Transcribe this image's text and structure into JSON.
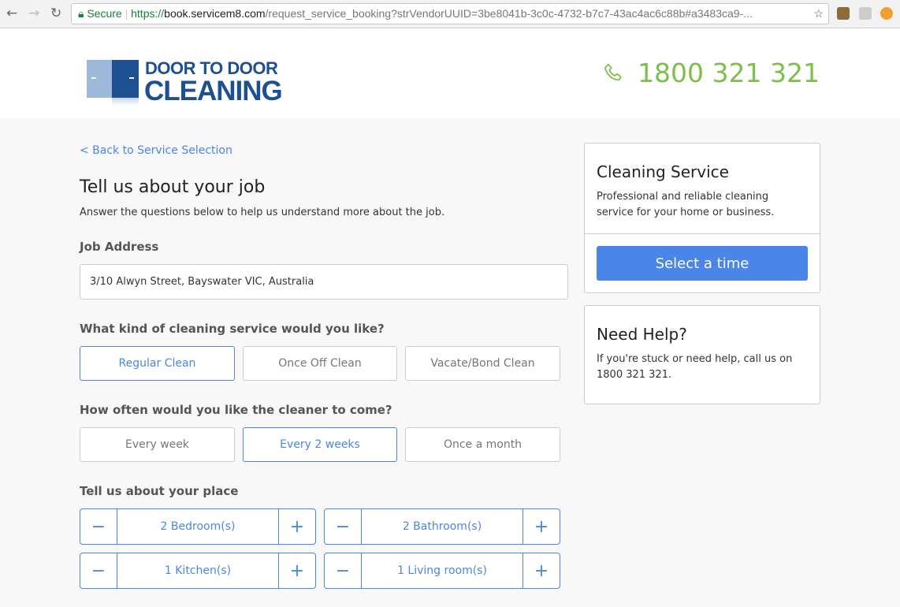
{
  "browser": {
    "secure_label": "Secure",
    "url_scheme": "https://",
    "url_host": "book.servicem8.com",
    "url_path": "/request_service_booking?strVendorUUID=3be8041b-3c0c-4732-b7c7-43ac4ac6c88b#a3483ca9-..."
  },
  "header": {
    "logo_line1": "DOOR TO DOOR",
    "logo_line2": "CLEANING",
    "phone": "1800 321 321",
    "accent": "#7cc04b"
  },
  "main": {
    "back_link": "< Back to Service Selection",
    "title": "Tell us about your job",
    "subtitle": "Answer the questions below to help us understand more about the job.",
    "address_label": "Job Address",
    "address_value": "3/10 Alwyn Street, Bayswater VIC, Australia",
    "service_question": "What kind of cleaning service would you like?",
    "service_options": [
      {
        "label": "Regular Clean",
        "selected": true
      },
      {
        "label": "Once Off Clean",
        "selected": false
      },
      {
        "label": "Vacate/Bond Clean",
        "selected": false
      }
    ],
    "frequency_question": "How often would you like the cleaner to come?",
    "frequency_options": [
      {
        "label": "Every week",
        "selected": false
      },
      {
        "label": "Every 2 weeks",
        "selected": true
      },
      {
        "label": "Once a month",
        "selected": false
      }
    ],
    "place_label": "Tell us about your place",
    "steppers": [
      {
        "value": "2 Bedroom(s)"
      },
      {
        "value": "2 Bathroom(s)"
      },
      {
        "value": "1 Kitchen(s)"
      },
      {
        "value": "1 Living room(s)"
      }
    ],
    "minus": "−",
    "plus": "+"
  },
  "sidebar": {
    "service_title": "Cleaning Service",
    "service_desc": "Professional and reliable cleaning service for your home or business.",
    "select_time": "Select a time",
    "help_title": "Need Help?",
    "help_text": "If you're stuck or need help, call us on 1800 321 321."
  },
  "colors": {
    "primary": "#4a86e8",
    "brand": "#1d4f93"
  }
}
